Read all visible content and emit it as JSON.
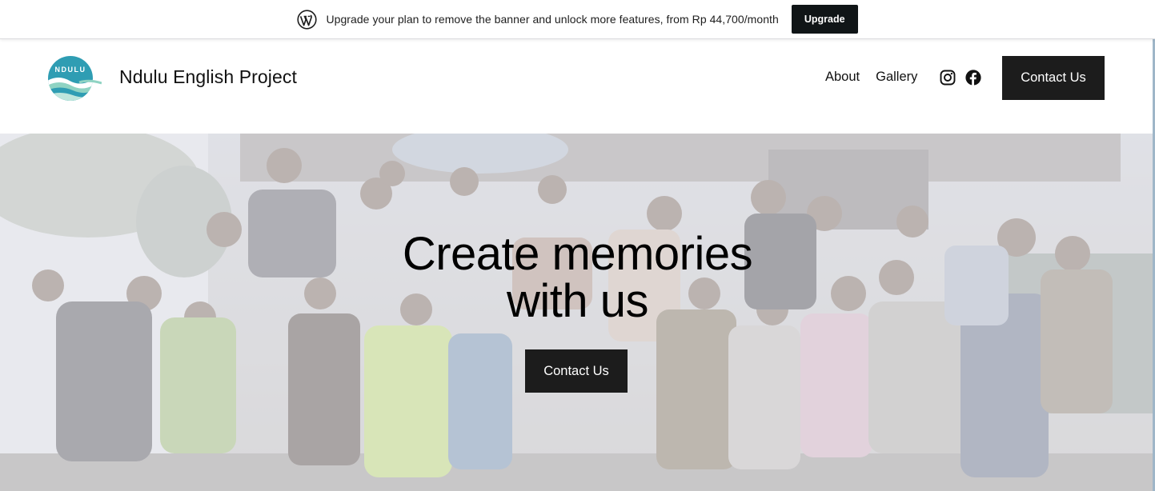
{
  "banner": {
    "text": "Upgrade your plan to remove the banner and unlock more features, from Rp 44,700/month",
    "button_label": "Upgrade",
    "icon": "wordpress-icon"
  },
  "header": {
    "logo_text": "NDULU",
    "site_title": "Ndulu English Project",
    "nav": [
      {
        "label": "About"
      },
      {
        "label": "Gallery"
      }
    ],
    "social": [
      "instagram-icon",
      "facebook-icon"
    ],
    "cta_label": "Contact Us"
  },
  "hero": {
    "title_line1": "Create memories",
    "title_line2": "with us",
    "cta_label": "Contact Us",
    "background": "group-photo"
  },
  "colors": {
    "button_dark": "#1c1c1c",
    "logo_teal": "#2f9db3",
    "logo_wave": "#bfe6dc"
  }
}
